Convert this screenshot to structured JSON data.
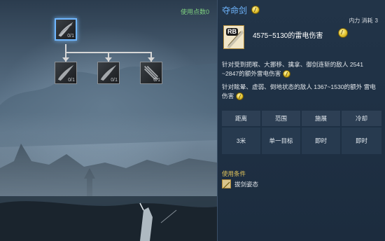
{
  "skill_tree": {
    "points_label": "使用点数0",
    "nodes": [
      {
        "level": "0/1",
        "selected": true
      },
      {
        "level": "0/1",
        "selected": false
      },
      {
        "level": "0/1",
        "selected": false
      },
      {
        "level": "0/1",
        "selected": false
      }
    ]
  },
  "tooltip": {
    "skill_name": "夺命剑",
    "cost_label": "内力 消耗",
    "cost_value": "3",
    "icon_badge": "RB",
    "damage": "4575~5130的雷电伤害",
    "desc1": "针对受到扼喉、大挪移、擒拿、御剑连斩的敌人 2541 ~2847的额外雷电伤害",
    "desc2": "针对眩晕、虚弱、倒地状态的敌人 1367~1530的额外 雷电伤害",
    "table": {
      "headers": [
        "距离",
        "范围",
        "施展",
        "冷却"
      ],
      "values": [
        "3米",
        "单一目标",
        "即时",
        "即时"
      ]
    },
    "conditions_label": "使用条件",
    "condition_text": "拔剑姿态"
  },
  "colors": {
    "skill_name": "#6fb6ff",
    "points": "#7fd17f",
    "conditions": "#e4c65c"
  }
}
